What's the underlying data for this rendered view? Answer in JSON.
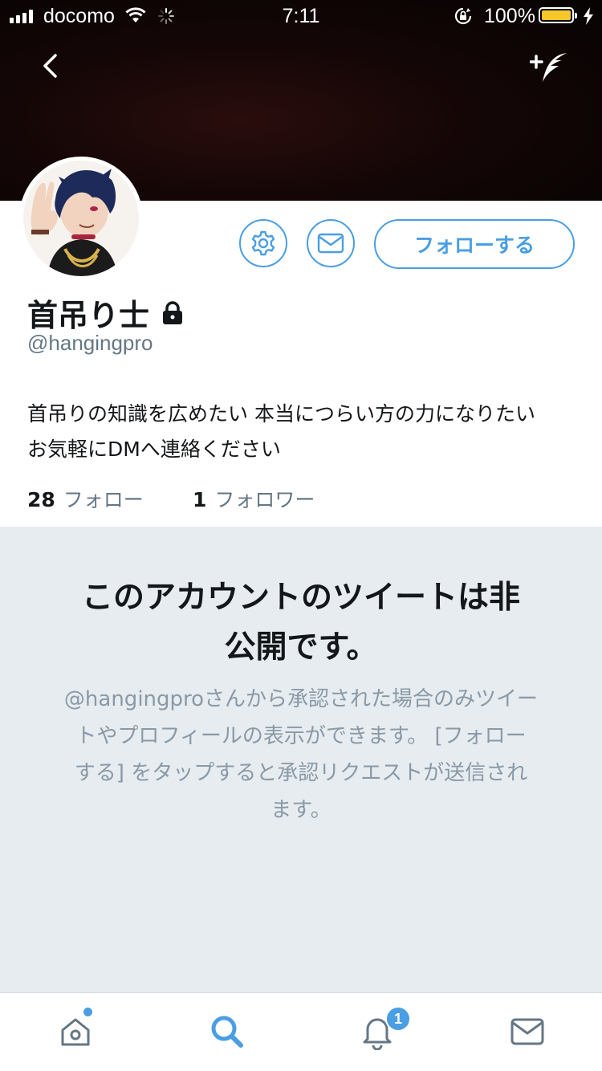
{
  "status_bar": {
    "carrier": "docomo",
    "time": "7:11",
    "battery_percent": "100%",
    "icons": [
      "signal-icon",
      "wifi-icon",
      "activity-spinner-icon",
      "rotation-lock-icon",
      "battery-icon",
      "charging-bolt-icon"
    ]
  },
  "header": {
    "icons": [
      "back-chevron-icon",
      "compose-tweet-icon"
    ]
  },
  "profile": {
    "name": "首吊り士",
    "handle": "@hangingpro",
    "bio_line1": "首吊りの知識を広めたい 本当につらい方の力になりたい",
    "bio_line2": "お気軽にDMへ連絡ください",
    "following_count": "28",
    "following_label": "フォロー",
    "followers_count": "1",
    "followers_label": "フォロワー",
    "actions": {
      "follow_label": "フォローする",
      "settings_icon": "gear-icon",
      "message_icon": "envelope-icon"
    }
  },
  "protected_notice": {
    "title_line1": "このアカウントのツイートは非",
    "title_line2": "公開です。",
    "desc_line1": "@hangingproさんから承認された場合のみツイー",
    "desc_line2": "トやプロフィールの表示ができます。 [フォロー",
    "desc_line3": "する] をタップすると承認リクエストが送信され",
    "desc_line4": "ます。"
  },
  "tab_bar": {
    "tabs": [
      "home-icon",
      "search-icon",
      "notifications-icon",
      "messages-icon"
    ],
    "notification_badge": "1",
    "active_tab": "search-icon"
  },
  "colors": {
    "accent": "#4a9ee3",
    "protected_bg": "#e6ecf0",
    "secondary_text": "#657786",
    "battery": "#f5c72a"
  }
}
